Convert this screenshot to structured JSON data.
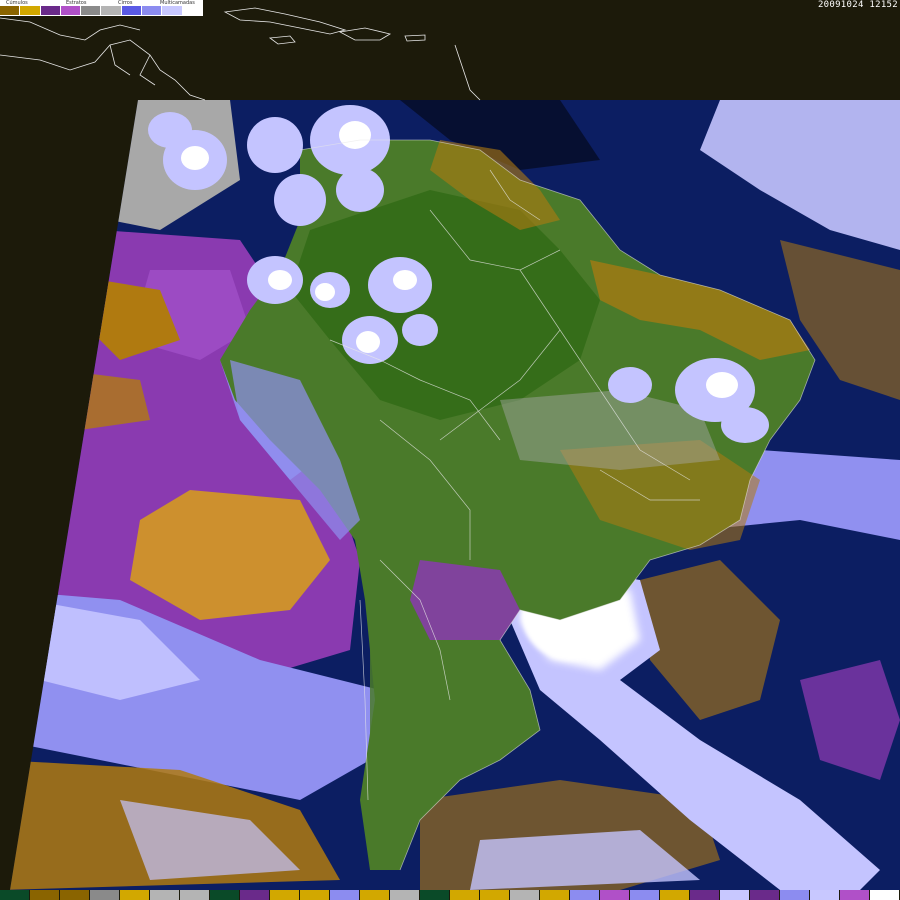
{
  "timestamp": "20091024 12152",
  "legend": {
    "labels": [
      "Cúmulos",
      "Estratos",
      "Cirros",
      "Multicamadas"
    ],
    "colors": [
      "#8a6400",
      "#d2a800",
      "#6a2a8a",
      "#b050c8",
      "#8a8a8a",
      "#b4b4b4",
      "#5a5ae6",
      "#8c8cf0",
      "#c8c8ff",
      "#ffffff"
    ]
  },
  "bottom_bar_colors": [
    "#0a4a28",
    "#8a6400",
    "#8a6400",
    "#8a8a8a",
    "#d2a800",
    "#b4b4b4",
    "#b4b4b4",
    "#0a4a28",
    "#6a2a8a",
    "#d2a800",
    "#d2a800",
    "#8c8cf0",
    "#d2a800",
    "#b4b4b4",
    "#0a4a28",
    "#d2a800",
    "#d2a800",
    "#b4b4b4",
    "#d2a800",
    "#8c8cf0",
    "#b050c8",
    "#8c8cf0",
    "#d2a800",
    "#6a2a8a",
    "#c8c8ff",
    "#6a2a8a",
    "#8c8cf0",
    "#c8c8ff",
    "#b050c8",
    "#ffffff"
  ],
  "colors": {
    "background": "#1c1a0a",
    "ocean": "#0c1e62",
    "land_forest": "#2f6a14",
    "land_dry": "#4a7a2a",
    "cumulus_low": "#b07a10",
    "cumulus_high": "#d8a018",
    "stratus": "#8a3ab0",
    "stratus_light": "#a050c8",
    "cirrus": "#9090f0",
    "cirrus_light": "#c4c4ff",
    "gray_cloud": "#a8a8a8",
    "white_cloud": "#ffffff",
    "coast": "#e8e8e8"
  }
}
